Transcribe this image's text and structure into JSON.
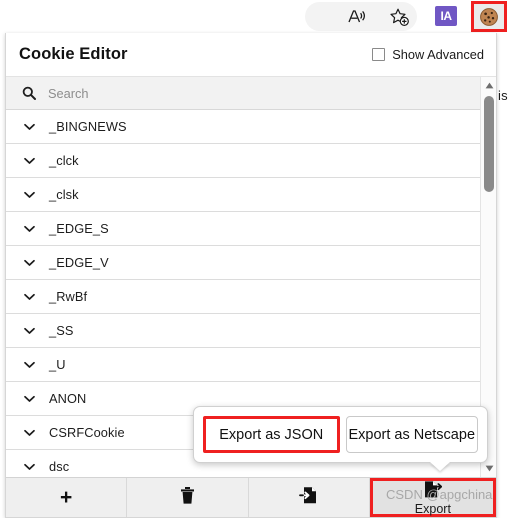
{
  "browser_toolbar": {
    "icons": [
      {
        "name": "read-aloud-icon",
        "glyph": "A"
      },
      {
        "name": "add-favorite-icon",
        "glyph": "star"
      },
      {
        "name": "immersive-reader-badge",
        "label": "IA",
        "color": "#7057c4"
      },
      {
        "name": "cookie-editor-extension-icon",
        "glyph": "cookie",
        "highlight_color": "#ef2020"
      }
    ]
  },
  "background_page": {
    "visible_text": "is"
  },
  "panel": {
    "title": "Cookie Editor",
    "show_advanced": {
      "label": "Show Advanced",
      "checked": false
    },
    "search": {
      "placeholder": "Search",
      "value": "",
      "icon": "search-icon"
    },
    "cookies": [
      {
        "name": "_BINGNEWS"
      },
      {
        "name": "_clck"
      },
      {
        "name": "_clsk"
      },
      {
        "name": "_EDGE_S"
      },
      {
        "name": "_EDGE_V"
      },
      {
        "name": "_RwBf"
      },
      {
        "name": "_SS"
      },
      {
        "name": "_U"
      },
      {
        "name": "ANON"
      },
      {
        "name": "CSRFCookie"
      },
      {
        "name": "dsc"
      }
    ],
    "scrollbar": {
      "up_arrow": "▲",
      "down_arrow": "▼"
    }
  },
  "export_popup": {
    "buttons": [
      {
        "label": "Export as JSON",
        "highlighted": true
      },
      {
        "label": "Export as Netscape",
        "highlighted": false
      }
    ]
  },
  "action_bar": {
    "buttons": [
      {
        "name": "add-cookie-button",
        "icon": "plus-icon",
        "label": ""
      },
      {
        "name": "delete-all-button",
        "icon": "trash-icon",
        "label": ""
      },
      {
        "name": "import-button",
        "icon": "import-file-icon",
        "label": ""
      },
      {
        "name": "export-button",
        "icon": "export-file-icon",
        "label": "Export",
        "active": true
      }
    ]
  },
  "watermark": {
    "text": "CSDN @apgchina"
  },
  "colors": {
    "highlight_red": "#ef2020",
    "accent_purple": "#7057c4",
    "panel_bg": "#ffffff",
    "toolbar_bg": "#efefef"
  }
}
